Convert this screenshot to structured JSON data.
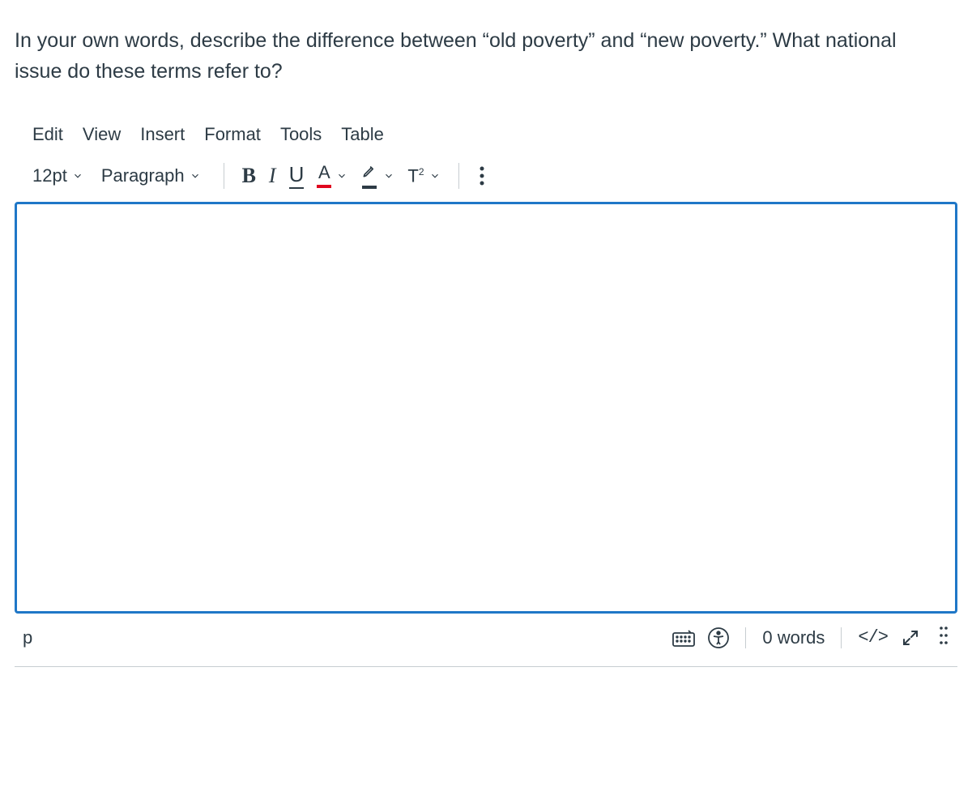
{
  "question": {
    "text": "In your own words, describe the difference between “old poverty” and “new poverty.”  What national issue do these terms refer to?"
  },
  "menubar": {
    "edit": "Edit",
    "view": "View",
    "insert": "Insert",
    "format": "Format",
    "tools": "Tools",
    "table": "Table"
  },
  "toolbar": {
    "font_size": "12pt",
    "block_format": "Paragraph",
    "text_color_swatch": "#e0061f"
  },
  "statusbar": {
    "path": "p",
    "word_count": "0 words",
    "code_label": "</>"
  }
}
